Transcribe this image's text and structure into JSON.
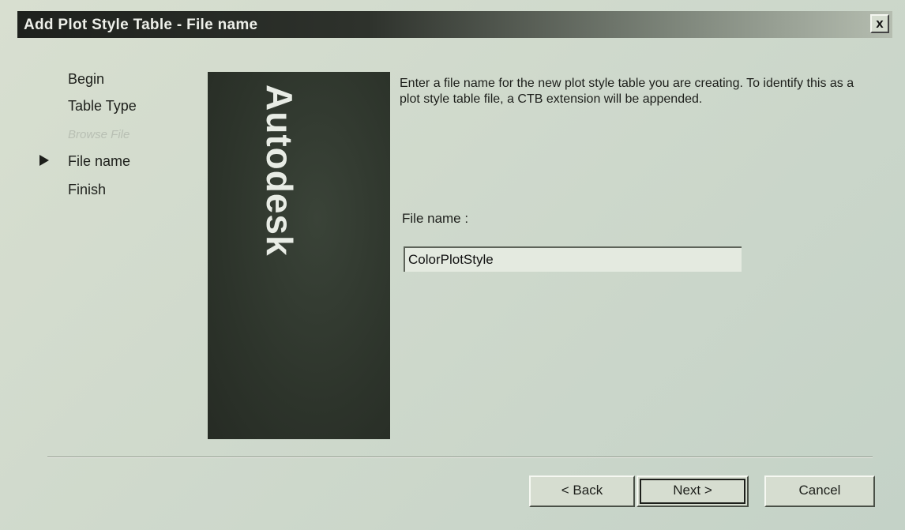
{
  "window": {
    "title": "Add Plot Style Table - File name",
    "close_label": "x"
  },
  "steps": [
    {
      "label": "Begin",
      "state": "done"
    },
    {
      "label": "Table Type",
      "state": "done"
    },
    {
      "label": "Browse File",
      "state": "disabled"
    },
    {
      "label": "File name",
      "state": "current"
    },
    {
      "label": "Finish",
      "state": "pending"
    }
  ],
  "banner": {
    "logo_text": "Autodesk",
    "background_color": "#2d342b"
  },
  "content": {
    "instructions": "Enter a file name for the new plot style table you are creating. To identify this as a plot style table file, a CTB extension will be appended.",
    "filename_label": "File name :",
    "filename_value": "ColorPlotStyle"
  },
  "buttons": {
    "back": "< Back",
    "next": "Next >",
    "cancel": "Cancel"
  }
}
